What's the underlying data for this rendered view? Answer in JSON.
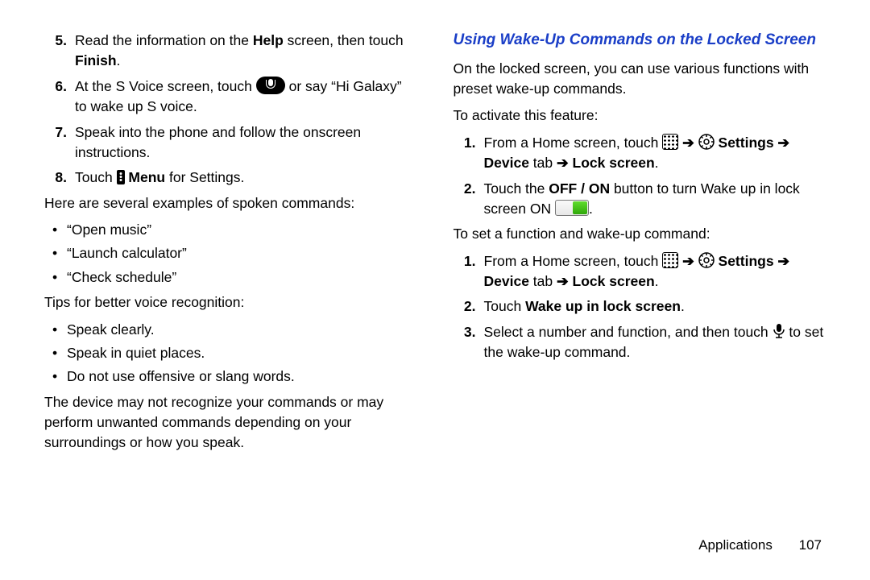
{
  "left": {
    "steps": [
      {
        "n": "5.",
        "parts": [
          "Read the information on the ",
          "Help",
          " screen, then touch ",
          "Finish",
          "."
        ]
      },
      {
        "n": "6.",
        "pre": "At the S Voice screen, touch ",
        "post": " or say “Hi Galaxy” to wake up S voice."
      },
      {
        "n": "7.",
        "text": "Speak into the phone and follow the onscreen instructions."
      },
      {
        "n": "8.",
        "pre": "Touch ",
        "mid": " Menu",
        "post": " for Settings."
      }
    ],
    "examples_intro": "Here are several examples of spoken commands:",
    "examples": [
      "“Open music”",
      "“Launch calculator”",
      "“Check schedule”"
    ],
    "tips_intro": "Tips for better voice recognition:",
    "tips": [
      "Speak clearly.",
      "Speak in quiet places.",
      "Do not use offensive or slang words."
    ],
    "warn": "The device may not recognize your commands or may perform unwanted commands depending on your surroundings or how you speak."
  },
  "right": {
    "heading": "Using Wake-Up Commands on the Locked Screen",
    "intro": "On the locked screen, you can use various functions with preset wake-up commands.",
    "activate_label": "To activate this feature:",
    "activate": [
      {
        "n": "1.",
        "pre": "From a Home screen, touch ",
        "arrow": " ➔ ",
        "settings": "Settings",
        "arrow2": " ➔ ",
        "device": "Device",
        "tab": " tab ",
        "arrow3": "➔ ",
        "lock": "Lock screen",
        "end": "."
      },
      {
        "n": "2.",
        "pre": "Touch the ",
        "off": "OFF / ON",
        "mid": " button to turn Wake up in lock screen ON ",
        "end": "."
      }
    ],
    "set_label": "To set a function and wake-up command:",
    "set": [
      {
        "n": "1.",
        "pre": "From a Home screen, touch ",
        "arrow": " ➔ ",
        "settings": "Settings",
        "arrow2": " ➔ ",
        "device": "Device",
        "tab": " tab ",
        "arrow3": "➔ ",
        "lock": "Lock screen",
        "end": "."
      },
      {
        "n": "2.",
        "pre": "Touch ",
        "wake": "Wake up in lock screen",
        "end": "."
      },
      {
        "n": "3.",
        "pre": "Select a number and function, and then touch ",
        "post": " to set the wake-up command."
      }
    ]
  },
  "footer": {
    "section": "Applications",
    "page": "107"
  }
}
